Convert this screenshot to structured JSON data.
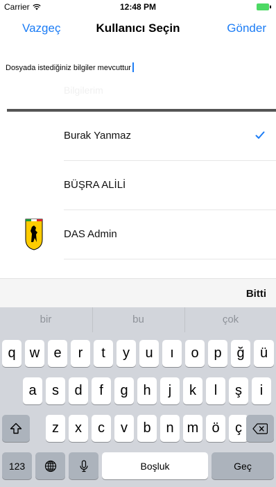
{
  "status_bar": {
    "carrier": "Carrier",
    "time": "12:48 PM"
  },
  "nav": {
    "left_label": "Vazgeç",
    "title": "Kullanıcı Seçin",
    "right_label": "Gönder"
  },
  "message": {
    "text": "Dosyada istediğiniz bilgiler mevcuttur",
    "ghost_text": "Bilgilerim"
  },
  "picker": {
    "items": [
      {
        "label": "Burak Yanmaz",
        "selected": true
      },
      {
        "label": "BÜŞRA ALİLİ",
        "selected": false
      },
      {
        "label": "DAS Admin",
        "selected": false,
        "avatar": "ferrari-logo"
      }
    ]
  },
  "accessory": {
    "done_label": "Bitti"
  },
  "keyboard": {
    "suggestions": [
      "bir",
      "bu",
      "çok"
    ],
    "row1": [
      "q",
      "w",
      "e",
      "r",
      "t",
      "y",
      "u",
      "ı",
      "o",
      "p",
      "ğ",
      "ü"
    ],
    "row2": [
      "a",
      "s",
      "d",
      "f",
      "g",
      "h",
      "j",
      "k",
      "l",
      "ş",
      "i"
    ],
    "row3": [
      "z",
      "x",
      "c",
      "v",
      "b",
      "n",
      "m",
      "ö",
      "ç"
    ],
    "numbers_label": "123",
    "space_label": "Boşluk",
    "return_label": "Geç",
    "icons": {
      "shift": "shift-arrow-icon",
      "backspace": "backspace-icon",
      "globe": "globe-icon",
      "mic": "microphone-icon"
    }
  },
  "colors": {
    "accent": "#1b7cf5",
    "keyboard_bg": "#d2d5db",
    "dark_key": "#acb3bc",
    "separator": "#555555"
  }
}
